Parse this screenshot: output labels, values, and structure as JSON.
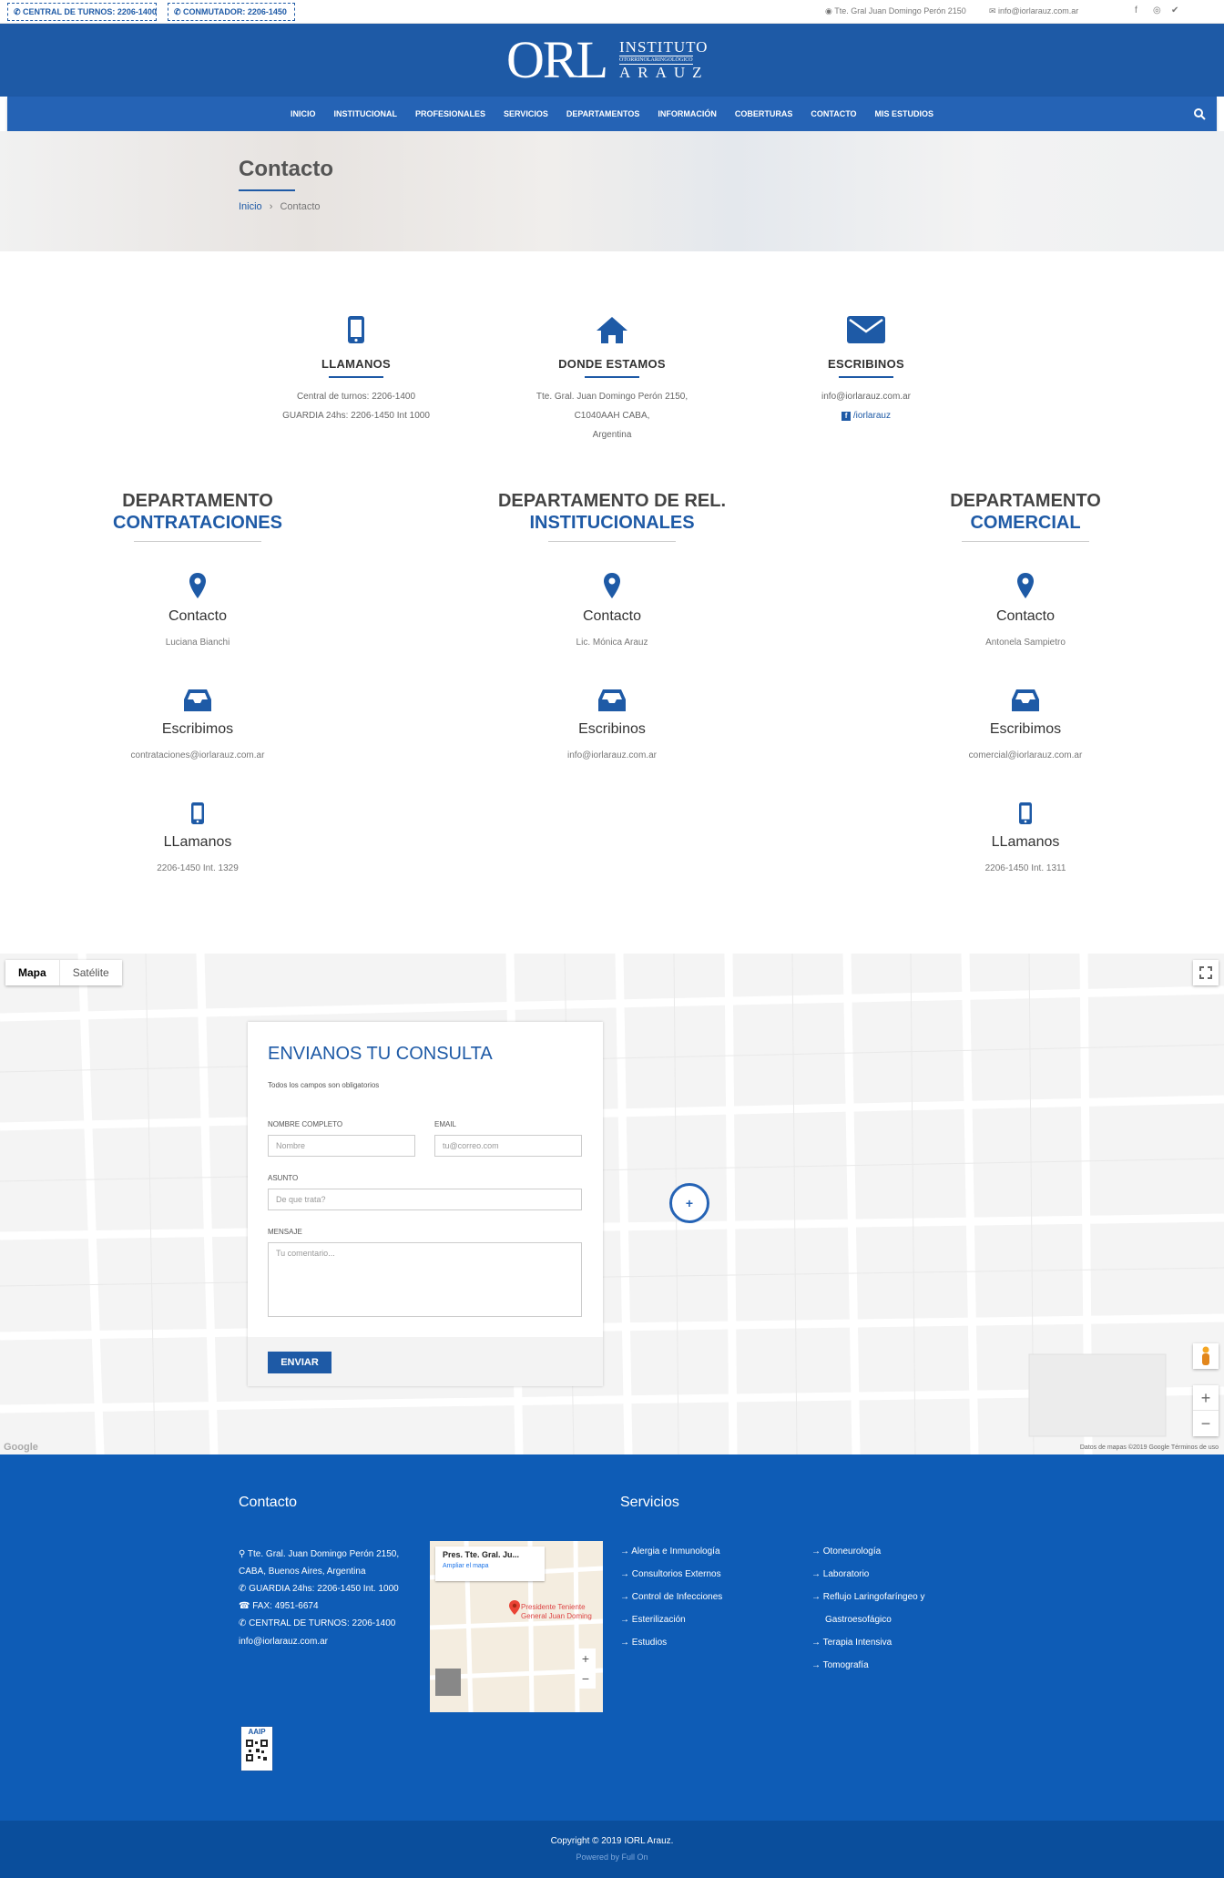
{
  "topbar": {
    "turnos": "CENTRAL DE TURNOS: 2206-1400",
    "conmutador": "CONMUTADOR: 2206-1450",
    "address": "Tte. Gral Juan Domingo Perón 2150",
    "email": "info@iorlarauz.com.ar",
    "social": [
      "facebook-icon",
      "instagram-icon",
      "twitter-icon"
    ]
  },
  "logo": {
    "orl": "ORL",
    "line1": "INSTITUTO",
    "line2": "OTORRINOLARINGOLÓGICO",
    "line3": "ARAUZ"
  },
  "nav": {
    "items": [
      "INICIO",
      "INSTITUCIONAL",
      "PROFESIONALES",
      "SERVICIOS",
      "DEPARTAMENTOS",
      "INFORMACIÓN",
      "COBERTURAS",
      "CONTACTO",
      "MIS ESTUDIOS"
    ]
  },
  "page": {
    "title": "Contacto",
    "breadcrumb_home": "Inicio",
    "breadcrumb_sep": "›",
    "breadcrumb_current": "Contacto"
  },
  "cards": {
    "llamanos": {
      "title": "LLAMANOS",
      "line1": "Central de turnos: 2206-1400",
      "line2": "GUARDIA 24hs: 2206-1450 Int 1000"
    },
    "donde": {
      "title": "DONDE ESTAMOS",
      "line1": "Tte. Gral. Juan Domingo Perón 2150,",
      "line2": "C1040AAH CABA,",
      "line3": "Argentina"
    },
    "escribinos": {
      "title": "ESCRIBINOS",
      "line1": "info@iorlarauz.com.ar",
      "facebook": "/iorlarauz"
    }
  },
  "departments": [
    {
      "t1": "DEPARTAMENTO",
      "t2": "CONTRATACIONES",
      "contact_label": "Contacto",
      "contact": "Luciana Bianchi",
      "write_label": "Escribimos",
      "email": "contrataciones@iorlarauz.com.ar",
      "call_label": "LLamanos",
      "phone": "2206-1450 Int. 1329"
    },
    {
      "t1": "DEPARTAMENTO DE REL.",
      "t2": "INSTITUCIONALES",
      "contact_label": "Contacto",
      "contact": "Lic. Mónica Arauz",
      "write_label": "Escribinos",
      "email": "info@iorlarauz.com.ar"
    },
    {
      "t1": "DEPARTAMENTO",
      "t2": "COMERCIAL",
      "contact_label": "Contacto",
      "contact": "Antonela Sampietro",
      "write_label": "Escribimos",
      "email": "comercial@iorlarauz.com.ar",
      "call_label": "LLamanos",
      "phone": "2206-1450 Int. 1311"
    }
  ],
  "map": {
    "tab_map": "Mapa",
    "tab_sat": "Satélite",
    "credit": "Datos de mapas ©2019 Google    Términos de uso",
    "logo": "Google",
    "zoom_in": "+",
    "zoom_out": "−"
  },
  "form": {
    "title": "ENVIANOS TU CONSULTA",
    "required_note": "Todos los campos son obligatorios",
    "name_label": "NOMBRE COMPLETO",
    "name_placeholder": "Nombre",
    "email_label": "EMAIL",
    "email_placeholder": "tu@correo.com",
    "subject_label": "ASUNTO",
    "subject_placeholder": "De que trata?",
    "message_label": "MENSAJE",
    "message_placeholder": "Tu comentario...",
    "submit": "ENVIAR"
  },
  "footer": {
    "contact_title": "Contacto",
    "address1": "Tte. Gral. Juan Domingo Perón 2150,",
    "address2": "CABA, Buenos Aires, Argentina",
    "guardia": "GUARDIA 24hs: 2206-1450 Int. 1000",
    "fax": "FAX: 4951-6674",
    "turnos": "CENTRAL DE TURNOS: 2206-1400",
    "email": "info@iorlarauz.com.ar",
    "minimap_title": "Pres. Tte. Gral. Ju...",
    "minimap_link": "Ampliar el mapa",
    "minimap_place": "Presidente Teniente General Juan Doming",
    "services_title": "Servicios",
    "services_col1": [
      "Alergia e Inmunología",
      "Consultorios Externos",
      "Control de Infecciones",
      "Esterilización",
      "Estudios"
    ],
    "services_col2": [
      "Otoneurología",
      "Laboratorio",
      "Reflujo Laringofaríngeo y",
      "Gastroesofágico",
      "Terapia Intensiva",
      "Tomografía"
    ],
    "aaip": "AAIP",
    "copyright": "Copyright © 2019 IORL Arauz.",
    "powered": "Powered by Full On"
  }
}
